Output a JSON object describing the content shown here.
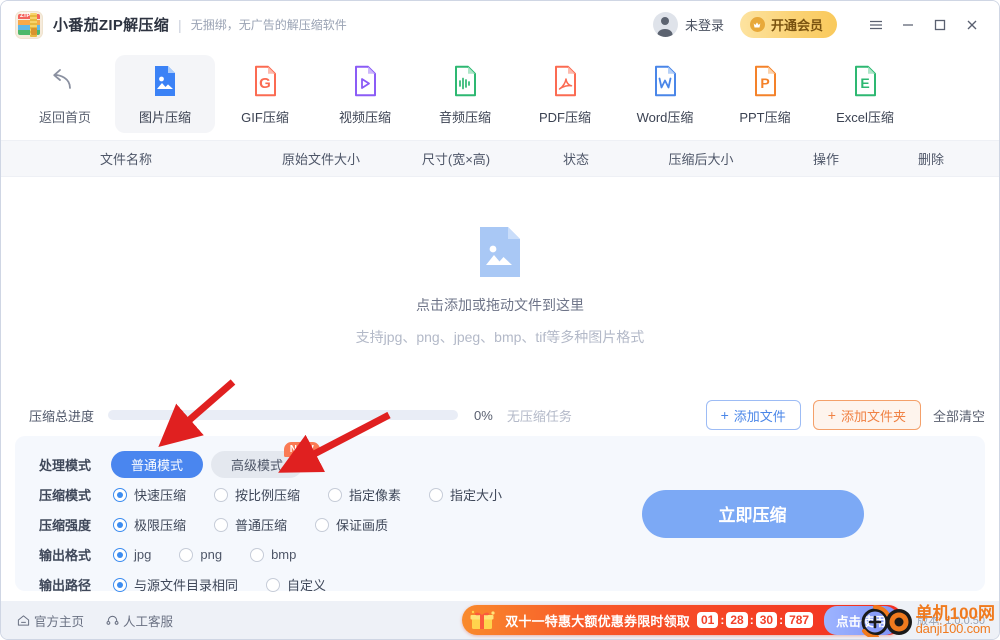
{
  "window": {
    "title": "小番茄ZIP解压缩",
    "divider": "|",
    "subtitle": "无捆绑，无广告的解压缩软件",
    "logo_text": "ZIP"
  },
  "account": {
    "login_label": "未登录",
    "vip_label": "开通会员",
    "avatar_icon": "user-avatar-icon",
    "vip_icon": "crown-badge-icon"
  },
  "window_controls": {
    "menu": "menu-icon",
    "minimize": "minimize-icon",
    "maximize": "maximize-icon",
    "close": "close-icon"
  },
  "toolbar": {
    "items": [
      {
        "label": "返回首页",
        "icon": "back-arrow-icon",
        "color": "#6b7280",
        "active": false
      },
      {
        "label": "图片压缩",
        "icon": "image-file-icon",
        "color": "#3b82f6",
        "active": true
      },
      {
        "label": "GIF压缩",
        "icon": "gif-file-icon",
        "color": "#fb6b52",
        "active": false
      },
      {
        "label": "视频压缩",
        "icon": "video-file-icon",
        "color": "#8b5cf6",
        "active": false
      },
      {
        "label": "音频压缩",
        "icon": "audio-file-icon",
        "color": "#2eb872",
        "active": false
      },
      {
        "label": "PDF压缩",
        "icon": "pdf-file-icon",
        "color": "#fb6b52",
        "active": false
      },
      {
        "label": "Word压缩",
        "icon": "word-file-icon",
        "color": "#4a86e8",
        "active": false
      },
      {
        "label": "PPT压缩",
        "icon": "ppt-file-icon",
        "color": "#f4822a",
        "active": false
      },
      {
        "label": "Excel压缩",
        "icon": "excel-file-icon",
        "color": "#2eb872",
        "active": false
      }
    ]
  },
  "table": {
    "columns": [
      "文件名称",
      "原始文件大小",
      "尺寸(宽×高)",
      "状态",
      "压缩后大小",
      "操作",
      "删除"
    ]
  },
  "dropzone": {
    "icon": "image-placeholder-icon",
    "primary": "点击添加或拖动文件到这里",
    "secondary": "支持jpg、png、jpeg、bmp、tif等多种图片格式"
  },
  "progress": {
    "label": "压缩总进度",
    "percent": "0%",
    "percent_value": 0,
    "status": "无压缩任务",
    "add_file_label": "添加文件",
    "add_folder_label": "添加文件夹",
    "clear_all_label": "全部清空",
    "plus": "+"
  },
  "settings": {
    "rows": [
      {
        "label": "处理模式",
        "type": "segment",
        "options": [
          {
            "text": "普通模式",
            "selected": true,
            "badge": null
          },
          {
            "text": "高级模式",
            "selected": false,
            "badge": "NEW"
          }
        ]
      },
      {
        "label": "压缩模式",
        "type": "radio",
        "options": [
          {
            "text": "快速压缩",
            "selected": true
          },
          {
            "text": "按比例压缩",
            "selected": false
          },
          {
            "text": "指定像素",
            "selected": false
          },
          {
            "text": "指定大小",
            "selected": false
          }
        ]
      },
      {
        "label": "压缩强度",
        "type": "radio",
        "options": [
          {
            "text": "极限压缩",
            "selected": true
          },
          {
            "text": "普通压缩",
            "selected": false
          },
          {
            "text": "保证画质",
            "selected": false
          }
        ]
      },
      {
        "label": "输出格式",
        "type": "radio",
        "options": [
          {
            "text": "jpg",
            "selected": true
          },
          {
            "text": "png",
            "selected": false
          },
          {
            "text": "bmp",
            "selected": false
          }
        ]
      },
      {
        "label": "输出路径",
        "type": "radio",
        "options": [
          {
            "text": "与源文件目录相同",
            "selected": true
          },
          {
            "text": "自定义",
            "selected": false
          }
        ]
      }
    ],
    "action_label": "立即压缩"
  },
  "footer": {
    "home_label": "官方主页",
    "home_icon": "home-icon",
    "support_label": "人工客服",
    "support_icon": "headset-icon",
    "version": "版本: 1.0.0.50",
    "promo": {
      "gift_icon": "gift-icon",
      "text": "双十一特惠大额优惠券限时领取",
      "countdown": [
        "01",
        "28",
        "30",
        "787"
      ],
      "separator": ":",
      "button_label": "点击使用"
    }
  },
  "watermark": {
    "line1": "单机100网",
    "line2": "danji100.com"
  },
  "annotations": {
    "arrows": [
      {
        "name": "arrow-to-normal-mode",
        "from": [
          232,
          381
        ],
        "to": [
          163,
          440
        ]
      },
      {
        "name": "arrow-to-ratio-option",
        "from": [
          388,
          414
        ],
        "to": [
          283,
          468
        ]
      }
    ],
    "color": "#e02020"
  },
  "colors": {
    "accent_blue": "#4a86ef",
    "accent_orange": "#f08143",
    "vip_gold": "#f9c95c",
    "panel_bg": "#f5f8fd",
    "annotation_red": "#e02020"
  }
}
